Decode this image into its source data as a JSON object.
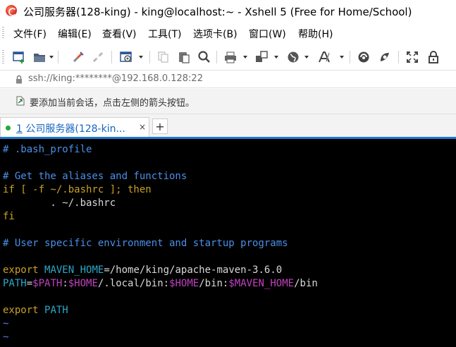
{
  "window": {
    "title": "公司服务器(128-king) - king@localhost:~ - Xshell 5 (Free for Home/School)"
  },
  "menu": {
    "items": [
      "文件(F)",
      "编辑(E)",
      "查看(V)",
      "工具(T)",
      "选项卡(B)",
      "窗口(W)",
      "帮助(H)"
    ]
  },
  "toolbar": {
    "buttons": [
      "new-session-icon",
      "open-folder-icon",
      "connect-icon",
      "disconnect-icon",
      "properties-icon",
      "copy-icon",
      "paste-icon",
      "find-icon",
      "print-icon",
      "transfer-icon",
      "globe-icon",
      "font-icon",
      "xftp-icon",
      "xmanager-icon",
      "fullscreen-icon",
      "lock-icon"
    ]
  },
  "address": {
    "value": "ssh://king:********@192.168.0.128:22"
  },
  "hint": {
    "text": "要添加当前会话，点击左侧的箭头按钮。"
  },
  "tabs": [
    {
      "number": "1",
      "label": "公司服务器(128-kin..."
    }
  ],
  "tab_close": "×",
  "tab_add": "+",
  "terminal": {
    "l1": "# .bash_profile",
    "l3": "# Get the aliases and functions",
    "l4_if": "if [ -f ~/.bashrc ]; then",
    "l5": "        . ~/.bashrc",
    "l6": "fi",
    "l8": "# User specific environment and startup programs",
    "l10_export": "export",
    "l10_var": "MAVEN_HOME",
    "l10_rest": "=/home/king/apache-maven-3.6.0",
    "l11_a": "PATH",
    "l11_b": "=",
    "l11_c": "$PATH",
    "l11_d": ":",
    "l11_e": "$HOME",
    "l11_f": "/.local/bin:",
    "l11_g": "$HOME",
    "l11_h": "/bin:",
    "l11_i": "$MAVEN_HOME",
    "l11_j": "/bin",
    "l13_export": "export",
    "l13_var": "PATH",
    "tilde": "~"
  },
  "colors": {
    "comment": "#4a8fe8",
    "keyword": "#c8a024",
    "env": "#2aa8c8",
    "variable": "#c040c0",
    "tab_accent": "#1e78d2",
    "tab_dot": "#21a93a"
  }
}
